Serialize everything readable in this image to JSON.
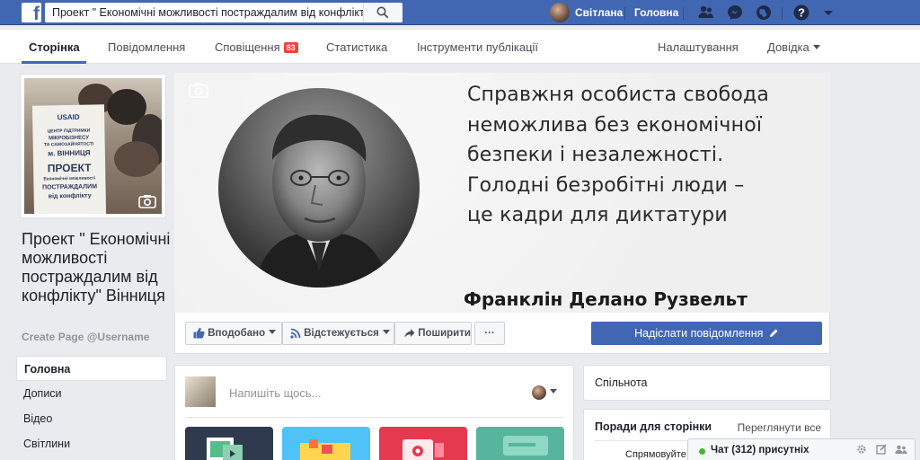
{
  "topbar": {
    "logo": "f",
    "search_value": "Проект \" Економічні можливості постраждалим від конфлікту\" Вінниця",
    "user_name": "Світлана",
    "home_label": "Головна",
    "icons": [
      "friends-icon",
      "messenger-icon",
      "globe-notifications-icon",
      "help-icon",
      "account-menu-caret-icon"
    ]
  },
  "pagenav": {
    "items": [
      "Сторінка",
      "Повідомлення",
      "Сповіщення",
      "Статистика",
      "Інструменти публікації",
      "Налаштування",
      "Довідка"
    ],
    "notifications_badge": "83"
  },
  "profile": {
    "board_lines": [
      "ЦЕНТР ПІДТРИМКИ",
      "МІКРОБІЗНЕСУ",
      "ТА САМОЗАЙНЯТОСТІ",
      "м. ВІННИЦЯ",
      "ПРОЕКТ",
      "Економічні можливості",
      "ПОСТРАЖДАЛИМ",
      "від конфлікту"
    ],
    "logo_text": "USAID",
    "page_name": "Проект \" Економічні можливості постраждалим від конфлікту\" Вінниця",
    "username_link": "Create Page @Username"
  },
  "left_menu": {
    "items": [
      "Головна",
      "Дописи",
      "Відео",
      "Світлини"
    ]
  },
  "cover": {
    "quote_lines": [
      "Справжня особиста свобода",
      "неможлива без економічної",
      "безпеки і незалежності.",
      "Голодні безробітні люди –",
      "це кадри для диктатури"
    ],
    "author": "Франклін Делано Рузвельт"
  },
  "actions": {
    "liked": "Вподобано",
    "following": "Відстежується",
    "share": "Поширити",
    "more": "···",
    "send_message": "Надіслати повідомлення"
  },
  "composer": {
    "placeholder": "Напишіть щось..."
  },
  "right": {
    "community_title": "Спільнота",
    "tips_title": "Поради для сторінки",
    "tips_link": "Переглянути все",
    "tip_preview": "Спрямовуйте л"
  },
  "chat": {
    "label": "Чат (312) присутніх"
  },
  "colors": {
    "fb_blue": "#4267b2",
    "badge_red": "#fa3e3e",
    "online_green": "#42b72a"
  }
}
